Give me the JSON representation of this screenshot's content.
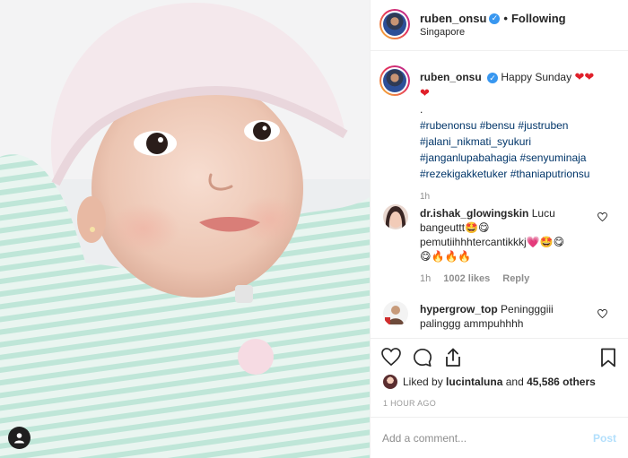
{
  "header": {
    "username": "ruben_onsu",
    "separator": "•",
    "follow_status": "Following",
    "location": "Singapore"
  },
  "caption": {
    "username": "ruben_onsu",
    "text": "Happy Sunday",
    "hearts": "❤❤",
    "heart2": "❤",
    "dot_line": ".",
    "hashtags": [
      "#rubenonsu #bensu #justruben",
      "#jalani_nikmati_syukuri",
      "#janganlupabahagia #senyuminaja",
      "#rezekigakketuker #thaniaputrionsu"
    ],
    "time": "1h"
  },
  "comments": [
    {
      "username": "dr.ishak_glowingskin",
      "text_line1": "Lucu",
      "text_line2": "bangeuttt🤩😋",
      "text_line3": "pemutiihhhtercantikkkj💗🤩😋",
      "text_line4": "😋🔥🔥🔥",
      "time": "1h",
      "likes": "1002 likes",
      "reply": "Reply"
    },
    {
      "username": "hypergrow_top",
      "text_line1": "Peningggiii",
      "text_line2": "palinggg ammpuhhhh"
    }
  ],
  "likes": {
    "prefix": "Liked by",
    "user": "lucintaluna",
    "and": "and",
    "others": "45,586 others"
  },
  "timestamp": "1 HOUR AGO",
  "add_comment": {
    "placeholder": "Add a comment...",
    "post_label": "Post"
  },
  "colors": {
    "verified": "#3897f0",
    "heart": "#e0202a",
    "hashtag": "#003569",
    "muted": "#8e8e8e",
    "post_disabled": "#b2dffc"
  }
}
